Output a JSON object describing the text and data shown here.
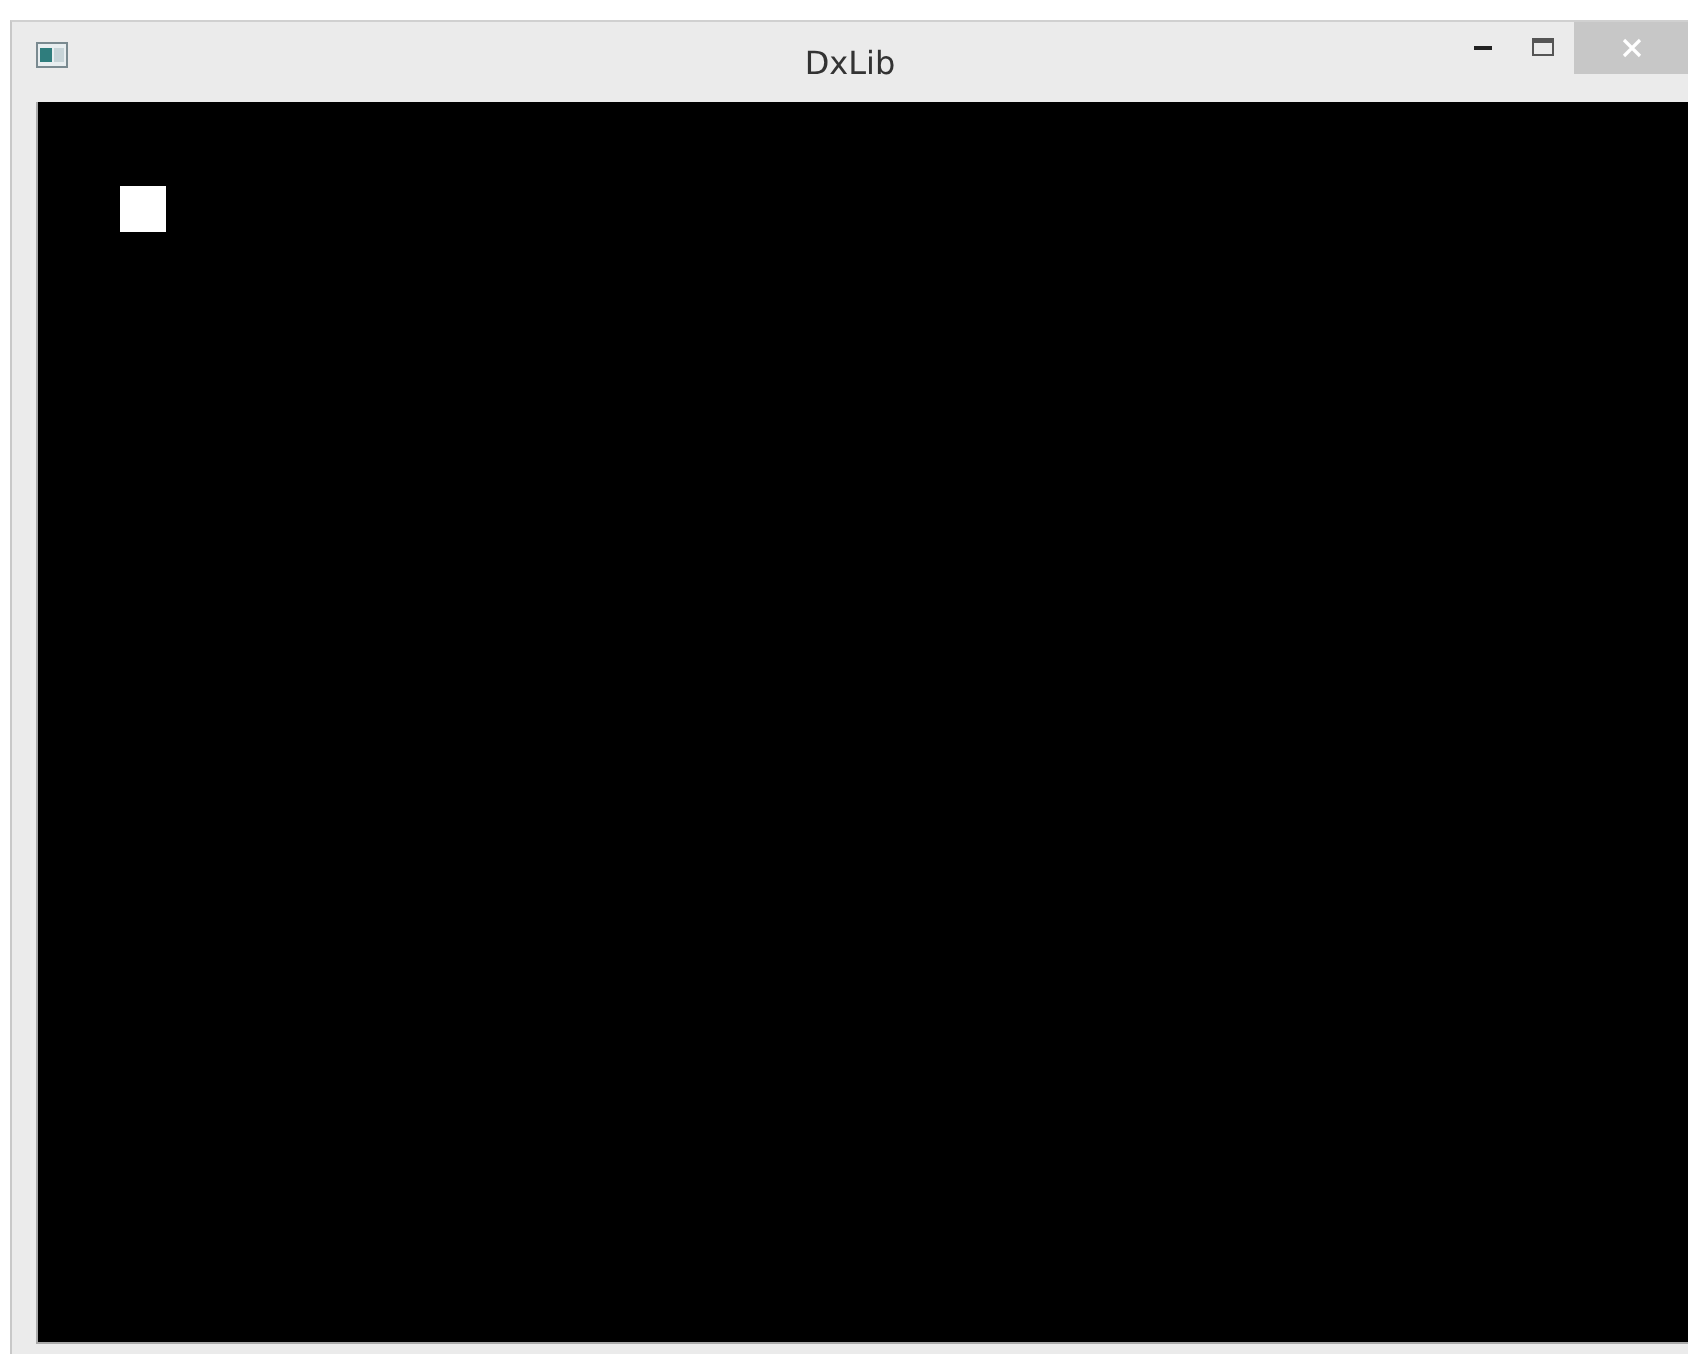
{
  "window": {
    "title": "DxLib"
  }
}
